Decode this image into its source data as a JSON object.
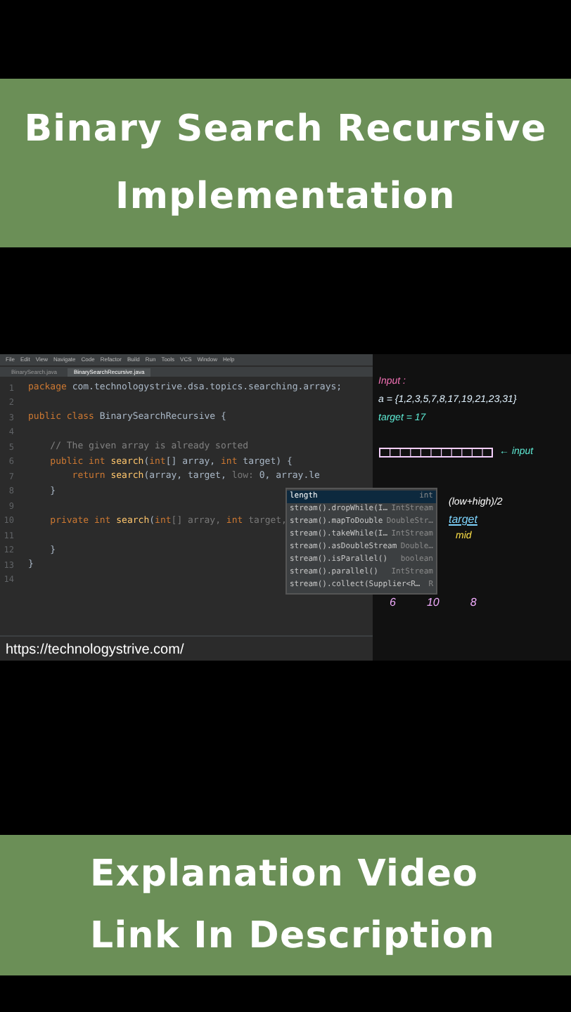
{
  "top_banner": {
    "lines": [
      "Binary Search Recursive",
      "Implementation"
    ]
  },
  "ide": {
    "menu": [
      "File",
      "Edit",
      "View",
      "Navigate",
      "Code",
      "Refactor",
      "Build",
      "Run",
      "Tools",
      "VCS",
      "Window",
      "Help"
    ],
    "tabs": [
      {
        "label": "BinarySearch.java",
        "selected": false
      },
      {
        "label": "BinarySearchRecursive.java",
        "selected": true
      }
    ],
    "lines": [
      {
        "number": "1",
        "segments": [
          {
            "kind": "keyword",
            "text": "package "
          },
          {
            "kind": "plain",
            "text": "com.technologystrive.dsa.topics.searching.arrays;"
          }
        ]
      },
      {
        "number": "2"
      },
      {
        "number": "3",
        "segments": [
          {
            "kind": "keyword",
            "text": "public class "
          },
          {
            "kind": "plain",
            "text": "BinarySearchRecursive {"
          }
        ]
      },
      {
        "number": "4"
      },
      {
        "number": "5",
        "segments": [
          {
            "kind": "comment",
            "text": "    // The given array is already sorted"
          }
        ]
      },
      {
        "number": "6",
        "segments": [
          {
            "kind": "keyword",
            "text": "    public int "
          },
          {
            "kind": "method",
            "text": "search"
          },
          {
            "kind": "plain",
            "text": "("
          },
          {
            "kind": "keyword",
            "text": "int"
          },
          {
            "kind": "plain",
            "text": "[] array, "
          },
          {
            "kind": "keyword",
            "text": "int "
          },
          {
            "kind": "plain",
            "text": "target) {"
          }
        ]
      },
      {
        "number": "7",
        "segments": [
          {
            "kind": "keyword",
            "text": "        return "
          },
          {
            "kind": "method",
            "text": "search"
          },
          {
            "kind": "plain",
            "text": "(array, target, "
          },
          {
            "kind": "hint",
            "text": "low: "
          },
          {
            "kind": "plain",
            "text": "0, array.le"
          }
        ]
      },
      {
        "number": "8",
        "segments": [
          {
            "kind": "plain",
            "text": "    }"
          }
        ]
      },
      {
        "number": "9"
      },
      {
        "number": "10",
        "segments": [
          {
            "kind": "keyword",
            "text": "    private int "
          },
          {
            "kind": "method",
            "text": "search"
          },
          {
            "kind": "plain",
            "text": "("
          },
          {
            "kind": "keyword",
            "text": "int"
          },
          {
            "kind": "hint",
            "text": "[] array, "
          },
          {
            "kind": "keyword",
            "text": "int "
          },
          {
            "kind": "hint",
            "text": "target,"
          }
        ]
      },
      {
        "number": "11"
      },
      {
        "number": "12",
        "segments": [
          {
            "kind": "plain",
            "text": "    }"
          }
        ]
      },
      {
        "number": "13",
        "segments": [
          {
            "kind": "plain",
            "text": "}"
          }
        ]
      },
      {
        "number": "14"
      }
    ],
    "completion": [
      {
        "label": "length",
        "type": "int",
        "selected": true
      },
      {
        "label": "stream().dropWhile(I…",
        "type": "IntStream",
        "selected": false
      },
      {
        "label": "stream().mapToDouble",
        "type": "DoubleStr…",
        "selected": false
      },
      {
        "label": "stream().takeWhile(I…",
        "type": "IntStream",
        "selected": false
      },
      {
        "label": "stream().asDoubleStream",
        "type": "Double…",
        "selected": false
      },
      {
        "label": "stream().isParallel()",
        "type": "boolean",
        "selected": false
      },
      {
        "label": "stream().parallel()",
        "type": "IntStream",
        "selected": false
      },
      {
        "label": "stream().collect(Supplier<R…",
        "type": "R",
        "selected": false
      }
    ],
    "url": "https://technologystrive.com/"
  },
  "whiteboard": {
    "notes": [
      {
        "text": "Input :",
        "color": "#f472b6"
      },
      {
        "text": "a = {1,2,3,5,7,8,17,19,21,23,31}",
        "color": "#e0f2fe"
      },
      {
        "text": "target = 17",
        "color": "#5eead4"
      }
    ],
    "input_label": "← input",
    "formula": "(low+high)/2",
    "target_label": "target",
    "mid_label": "mid",
    "numbers": [
      "6",
      "10",
      "8"
    ]
  },
  "bottom_banner": {
    "lines": [
      "Explanation Video",
      "Link In Description"
    ]
  }
}
